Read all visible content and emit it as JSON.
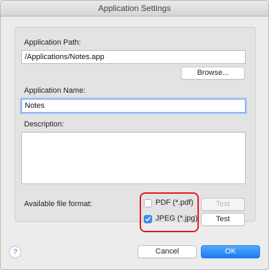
{
  "window": {
    "title": "Application Settings"
  },
  "path": {
    "label": "Application Path:",
    "value": "/Applications/Notes.app",
    "browse_label": "Browse..."
  },
  "name": {
    "label": "Application Name:",
    "value": "Notes"
  },
  "description": {
    "label": "Description:",
    "value": ""
  },
  "formats": {
    "label": "Available file format:",
    "pdf": {
      "label": "PDF (*.pdf)",
      "checked": false,
      "test_label": "Test",
      "test_enabled": false
    },
    "jpeg": {
      "label": "JPEG (*.jpg)",
      "checked": true,
      "test_label": "Test",
      "test_enabled": true
    }
  },
  "footer": {
    "help_glyph": "?",
    "cancel_label": "Cancel",
    "ok_label": "OK"
  },
  "colors": {
    "accent": "#1b7af0",
    "highlight": "#e0161d"
  },
  "icons": {
    "help": "help-icon",
    "check": "checkmark-icon"
  }
}
